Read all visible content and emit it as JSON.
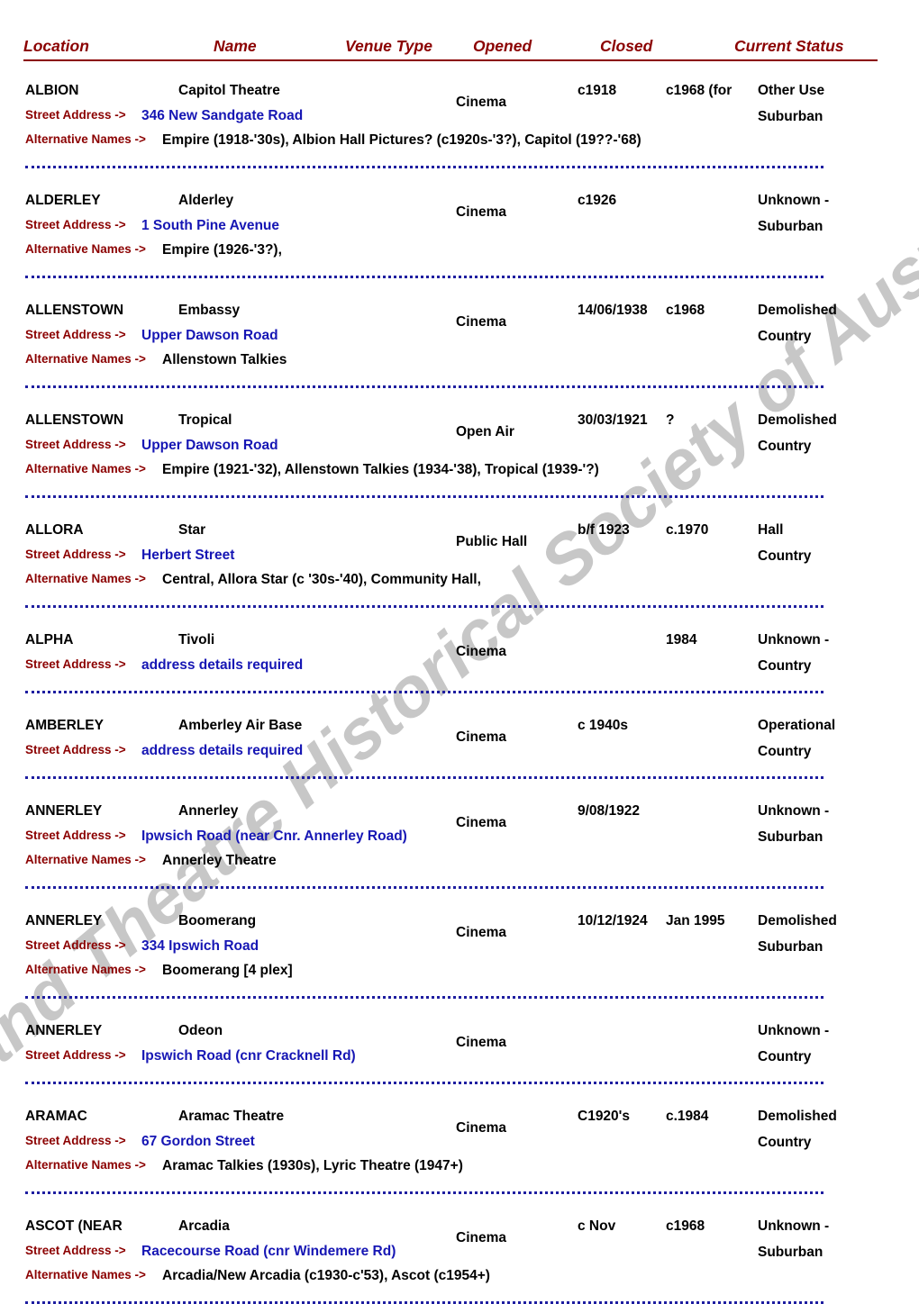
{
  "watermark": {
    "text": "Cinema and Theatre Historical Society of Australia Inc."
  },
  "colors": {
    "header": "#8B0000",
    "label": "#8B0000",
    "address_value": "#1616B4",
    "separator": "#1E1EA0",
    "body_text": "#000000"
  },
  "table": {
    "columns": [
      {
        "key": "location",
        "label": "Location"
      },
      {
        "key": "name",
        "label": "Name"
      },
      {
        "key": "venue_type",
        "label": "Venue Type"
      },
      {
        "key": "opened",
        "label": "Opened"
      },
      {
        "key": "closed",
        "label": "Closed"
      },
      {
        "key": "current_status",
        "label": "Current Status"
      }
    ],
    "labels": {
      "street_address": "Street Address ->",
      "alternative_names": "Alternative Names ->"
    },
    "records": [
      {
        "location": "ALBION",
        "name": "Capitol Theatre",
        "venue_type": "Cinema",
        "opened": "c1918",
        "closed": "c1968 (for",
        "status_line1": "Other Use",
        "status_line2": "Suburban",
        "street_address": "346 New Sandgate Road",
        "alternative_names": "Empire (1918-'30s), Albion Hall Pictures? (c1920s-'3?), Capitol (19??-'68)"
      },
      {
        "location": "ALDERLEY",
        "name": "Alderley",
        "venue_type": "Cinema",
        "opened": "c1926",
        "closed": "",
        "status_line1": "Unknown -",
        "status_line2": "Suburban",
        "street_address": "1 South Pine Avenue",
        "alternative_names": "Empire (1926-'3?),"
      },
      {
        "location": "ALLENSTOWN",
        "name": "Embassy",
        "venue_type": "Cinema",
        "opened": "14/06/1938",
        "closed": "c1968",
        "status_line1": "Demolished",
        "status_line2": "Country",
        "street_address": "Upper Dawson Road",
        "alternative_names": "Allenstown Talkies"
      },
      {
        "location": "ALLENSTOWN",
        "name": "Tropical",
        "venue_type": "Open Air",
        "opened": "30/03/1921",
        "closed": "?",
        "status_line1": "Demolished",
        "status_line2": "Country",
        "street_address": "Upper Dawson Road",
        "alternative_names": "Empire (1921-'32), Allenstown Talkies (1934-'38), Tropical (1939-'?)"
      },
      {
        "location": "ALLORA",
        "name": "Star",
        "venue_type": "Public Hall",
        "opened": "b/f 1923",
        "closed": "c.1970",
        "status_line1": "Hall",
        "status_line2": "Country",
        "street_address": "Herbert Street",
        "alternative_names": "Central, Allora Star (c '30s-'40), Community Hall,"
      },
      {
        "location": "ALPHA",
        "name": "Tivoli",
        "venue_type": "Cinema",
        "opened": "",
        "closed": "1984",
        "status_line1": "Unknown -",
        "status_line2": "Country",
        "street_address": "address details required",
        "alternative_names": ""
      },
      {
        "location": "AMBERLEY",
        "name": "Amberley Air Base",
        "venue_type": "Cinema",
        "opened": "c 1940s",
        "closed": "",
        "status_line1": "Operational",
        "status_line2": "Country",
        "street_address": "address details required",
        "alternative_names": ""
      },
      {
        "location": "ANNERLEY",
        "name": "Annerley",
        "venue_type": "Cinema",
        "opened": "9/08/1922",
        "closed": "",
        "status_line1": "Unknown -",
        "status_line2": "Suburban",
        "street_address": "Ipwsich Road (near Cnr. Annerley Road)",
        "alternative_names": "Annerley Theatre"
      },
      {
        "location": "ANNERLEY",
        "name": "Boomerang",
        "venue_type": "Cinema",
        "opened": "10/12/1924",
        "closed": "Jan 1995",
        "status_line1": "Demolished",
        "status_line2": "Suburban",
        "street_address": "334 Ipswich Road",
        "alternative_names": "Boomerang [4 plex]"
      },
      {
        "location": "ANNERLEY",
        "name": "Odeon",
        "venue_type": "Cinema",
        "opened": "",
        "closed": "",
        "status_line1": "Unknown -",
        "status_line2": "Country",
        "street_address": "Ipswich Road (cnr Cracknell Rd)",
        "alternative_names": ""
      },
      {
        "location": "ARAMAC",
        "name": "Aramac Theatre",
        "venue_type": "Cinema",
        "opened": "C1920's",
        "closed": "c.1984",
        "status_line1": "Demolished",
        "status_line2": "Country",
        "street_address": "67 Gordon Street",
        "alternative_names": "Aramac Talkies (1930s), Lyric Theatre (1947+)"
      },
      {
        "location": "ASCOT  (NEAR",
        "name": "Arcadia",
        "venue_type": "Cinema",
        "opened": "c Nov",
        "closed": "c1968",
        "status_line1": "Unknown -",
        "status_line2": "Suburban",
        "street_address": "Racecourse Road (cnr Windemere Rd)",
        "alternative_names": "Arcadia/New Arcadia  (c1930-c'53), Ascot (c1954+)"
      }
    ]
  }
}
